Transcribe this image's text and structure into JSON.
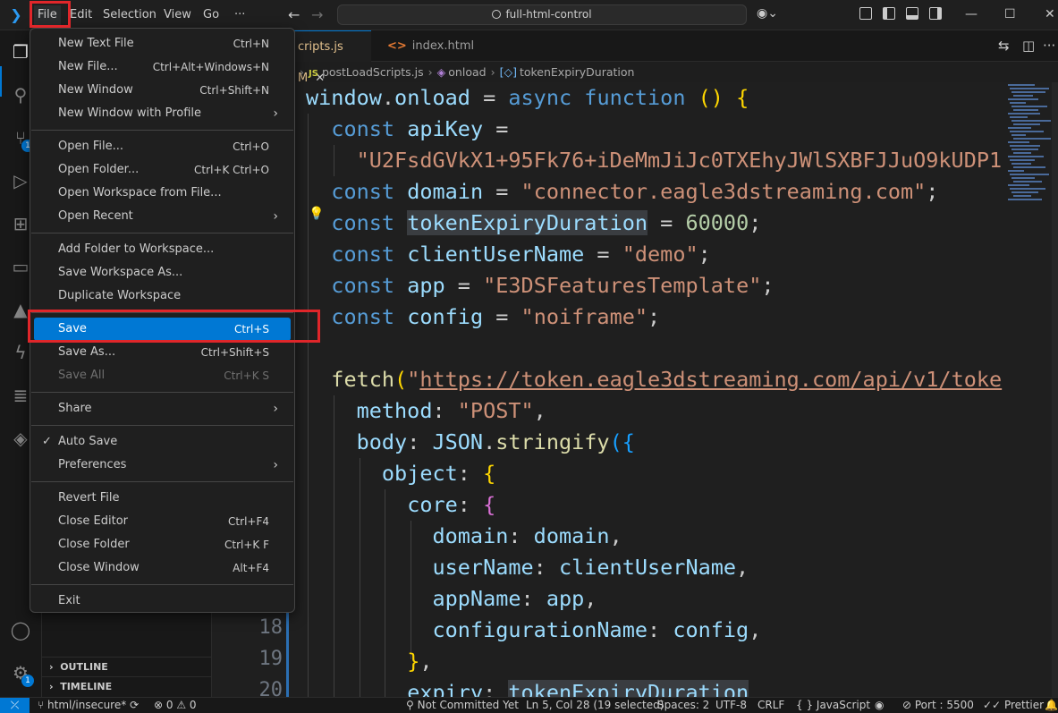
{
  "menubar": {
    "items": [
      "File",
      "Edit",
      "Selection",
      "View",
      "Go",
      "···"
    ],
    "search_text": "full-html-control"
  },
  "file_menu": {
    "groups": [
      [
        {
          "label": "New Text File",
          "shortcut": "Ctrl+N"
        },
        {
          "label": "New File...",
          "shortcut": "Ctrl+Alt+Windows+N"
        },
        {
          "label": "New Window",
          "shortcut": "Ctrl+Shift+N"
        },
        {
          "label": "New Window with Profile",
          "submenu": true
        }
      ],
      [
        {
          "label": "Open File...",
          "shortcut": "Ctrl+O"
        },
        {
          "label": "Open Folder...",
          "shortcut": "Ctrl+K Ctrl+O"
        },
        {
          "label": "Open Workspace from File..."
        },
        {
          "label": "Open Recent",
          "submenu": true
        }
      ],
      [
        {
          "label": "Add Folder to Workspace..."
        },
        {
          "label": "Save Workspace As..."
        },
        {
          "label": "Duplicate Workspace"
        }
      ],
      [
        {
          "label": "Save",
          "shortcut": "Ctrl+S",
          "selected": true
        },
        {
          "label": "Save As...",
          "shortcut": "Ctrl+Shift+S"
        },
        {
          "label": "Save All",
          "shortcut": "Ctrl+K S",
          "disabled": true
        }
      ],
      [
        {
          "label": "Share",
          "submenu": true
        }
      ],
      [
        {
          "label": "Auto Save",
          "checked": true
        },
        {
          "label": "Preferences",
          "submenu": true
        }
      ],
      [
        {
          "label": "Revert File"
        },
        {
          "label": "Close Editor",
          "shortcut": "Ctrl+F4"
        },
        {
          "label": "Close Folder",
          "shortcut": "Ctrl+K F"
        },
        {
          "label": "Close Window",
          "shortcut": "Alt+F4"
        }
      ],
      [
        {
          "label": "Exit"
        }
      ]
    ]
  },
  "tabs": {
    "active": {
      "label": "cripts.js",
      "status": "M"
    },
    "inactive": {
      "label": "index.html"
    }
  },
  "breadcrumb": {
    "file": "postLoadScripts.js",
    "func": "onload",
    "symbol": "tokenExpiryDuration"
  },
  "code_lines": [
    "window.onload = async function () {",
    "  const apiKey =",
    "    \"U2FsdGVkX1+95Fk76+iDeMmJiJc0TXEhyJWlSXBFJJuO9kUDP1",
    "  const domain = \"connector.eagle3dstreaming.com\";",
    "  const tokenExpiryDuration = 60000;",
    "  const clientUserName = \"demo\";",
    "  const app = \"E3DSFeaturesTemplate\";",
    "  const config = \"noiframe\";",
    "",
    "  fetch(\"https://token.eagle3dstreaming.com/api/v1/toke",
    "    method: \"POST\",",
    "    body: JSON.stringify({",
    "      object: {",
    "        core: {",
    "          domain: domain,",
    "          userName: clientUserName,",
    "          appName: app,",
    "          configurationName: config,",
    "        },",
    "        expiry: tokenExpiryDuration"
  ],
  "gutter_numbers": [
    "18",
    "19",
    "20"
  ],
  "sidebar": {
    "outline": "OUTLINE",
    "timeline": "TIMELINE"
  },
  "status": {
    "branch": "html/insecure*",
    "problems": "0",
    "warnings": "0",
    "commit": "Not Committed Yet",
    "position": "Ln 5, Col 28 (19 selected)",
    "spaces": "Spaces: 2",
    "encoding": "UTF-8",
    "eol": "CRLF",
    "language": "JavaScript",
    "port": "Port : 5500",
    "prettier": "Prettier"
  },
  "badges": {
    "source_control": "1",
    "settings": "1"
  },
  "colors": {
    "accent": "#0078d4",
    "highlight_box": "#e0262a"
  }
}
